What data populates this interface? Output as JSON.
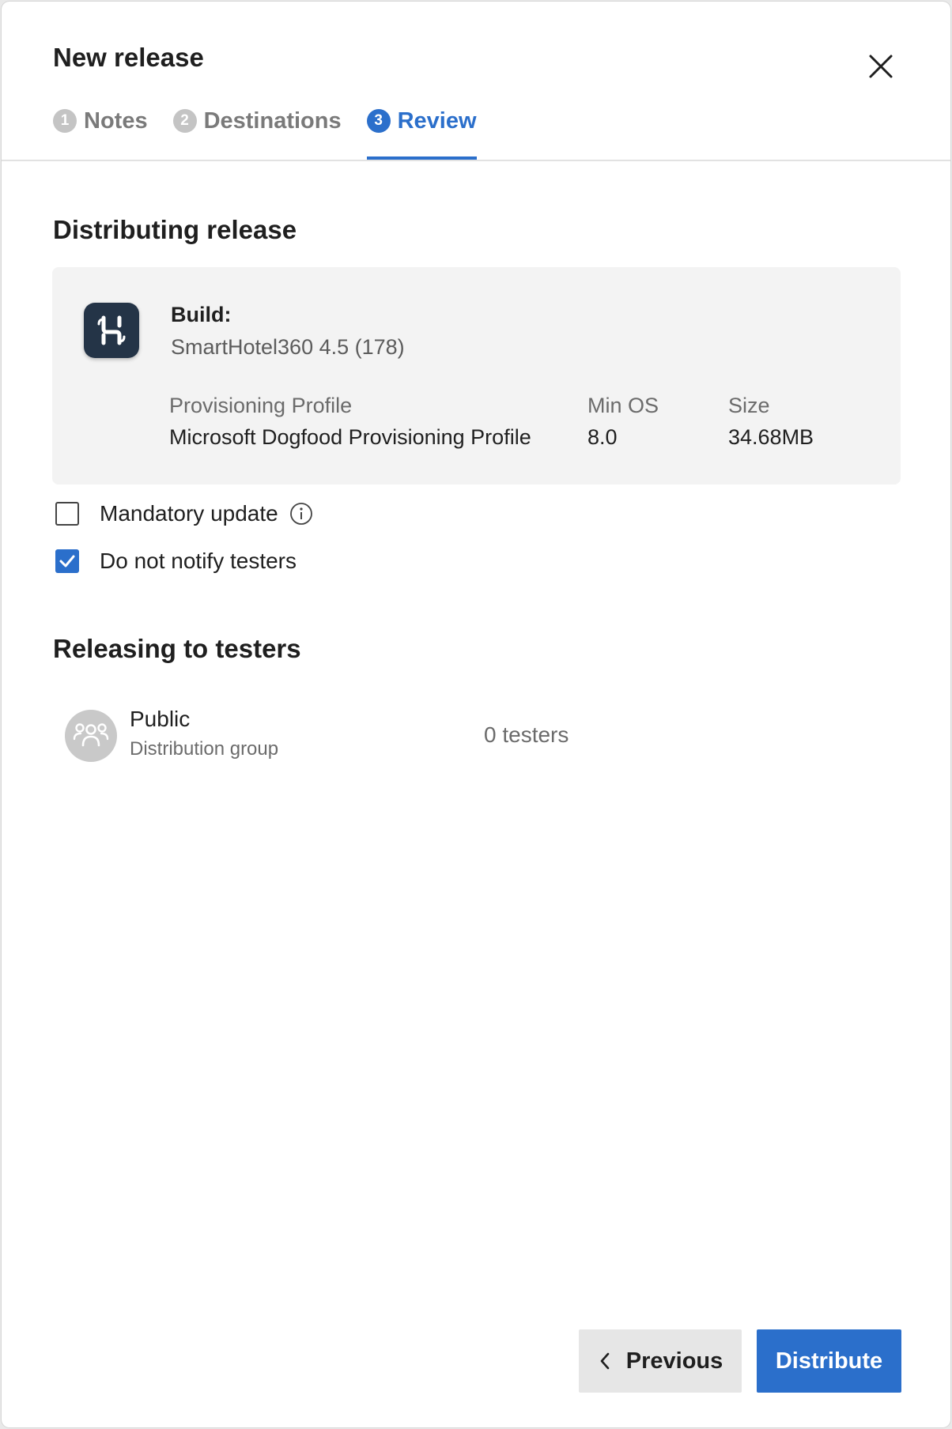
{
  "dialog": {
    "title": "New release",
    "close_icon": "close-icon"
  },
  "steps": [
    {
      "number": "1",
      "label": "Notes",
      "active": false
    },
    {
      "number": "2",
      "label": "Destinations",
      "active": false
    },
    {
      "number": "3",
      "label": "Review",
      "active": true
    }
  ],
  "distributing": {
    "title": "Distributing release",
    "app_icon": "smarthotel-app-icon",
    "build_label": "Build:",
    "build_value": "SmartHotel360 4.5 (178)",
    "provisioning_label": "Provisioning Profile",
    "provisioning_value": "Microsoft Dogfood Provisioning Profile",
    "min_os_label": "Min OS",
    "min_os_value": "8.0",
    "size_label": "Size",
    "size_value": "34.68MB"
  },
  "options": {
    "mandatory_update": {
      "label": "Mandatory update",
      "checked": false,
      "icon": "info-icon"
    },
    "do_not_notify": {
      "label": "Do not notify testers",
      "checked": true
    }
  },
  "releasing": {
    "title": "Releasing to testers",
    "groups": [
      {
        "name": "Public",
        "type": "Distribution group",
        "count": "0 testers",
        "icon": "group-icon"
      }
    ]
  },
  "footer": {
    "previous_label": "Previous",
    "distribute_label": "Distribute"
  },
  "colors": {
    "accent": "#2b6fcb",
    "app_icon_bg": "#243447",
    "card_bg": "#f3f3f3"
  }
}
